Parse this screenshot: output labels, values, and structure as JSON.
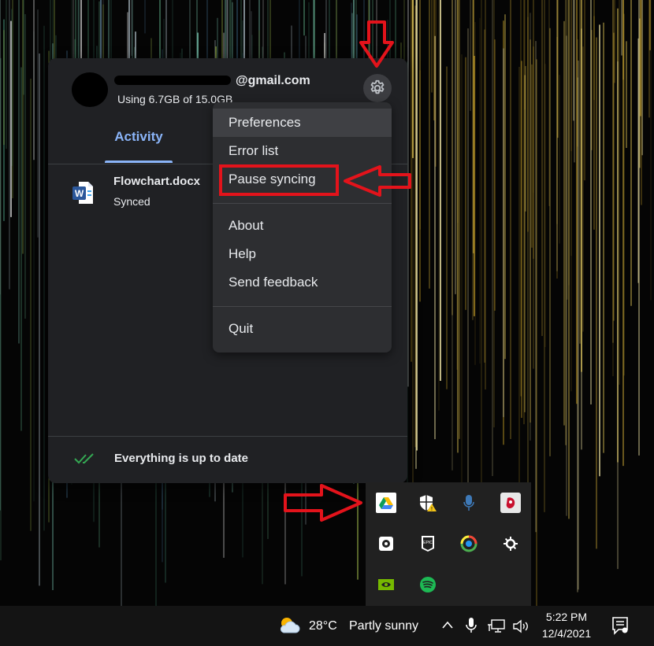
{
  "drive_panel": {
    "account_email": "@gmail.com",
    "storage_text": "Using 6.7GB of 15.0GB",
    "tab_label": "Activity",
    "files": [
      {
        "name": "Flowchart.docx",
        "status": "Synced",
        "icon": "word-document-icon"
      }
    ],
    "footer_status": "Everything is up to date"
  },
  "settings_menu": {
    "items": [
      "Preferences",
      "Error list",
      "Pause syncing"
    ],
    "items2": [
      "About",
      "Help",
      "Send feedback"
    ],
    "items3": [
      "Quit"
    ]
  },
  "tray_icons": [
    "google-drive-icon",
    "windows-security-warning-icon",
    "microphone-icon",
    "bloody-mouse-icon",
    "gear-app-icon",
    "epic-games-icon",
    "color-app-icon",
    "steelseries-icon",
    "nvidia-icon",
    "spotify-icon"
  ],
  "taskbar": {
    "temperature": "28°C",
    "weather": "Partly sunny",
    "time": "5:22 PM",
    "date": "12/4/2021"
  },
  "colors": {
    "annotation_red": "#e3131b",
    "accent_blue": "#8ab4f8",
    "synced_green": "#34a853"
  }
}
